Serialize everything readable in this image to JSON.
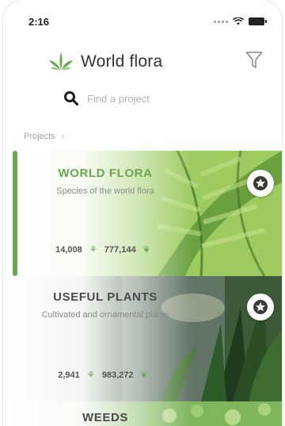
{
  "status_bar": {
    "time": "2:16"
  },
  "header": {
    "title": "World flora"
  },
  "search": {
    "placeholder": "Find a project"
  },
  "breadcrumb": {
    "label": "Projects",
    "chevron": "›"
  },
  "colors": {
    "accent": "#6aa84f",
    "title_green": "#6aa84f",
    "title_dark": "#4a4a4a"
  },
  "projects": [
    {
      "title": "WORLD FLORA",
      "subtitle": "Species of the world flora",
      "stat_a": "14,008",
      "stat_b": "777,144",
      "active": true
    },
    {
      "title": "USEFUL PLANTS",
      "subtitle": "Cultivated and ornamental plants",
      "stat_a": "2,941",
      "stat_b": "983,272",
      "active": false
    },
    {
      "title": "WEEDS",
      "active": false
    }
  ]
}
